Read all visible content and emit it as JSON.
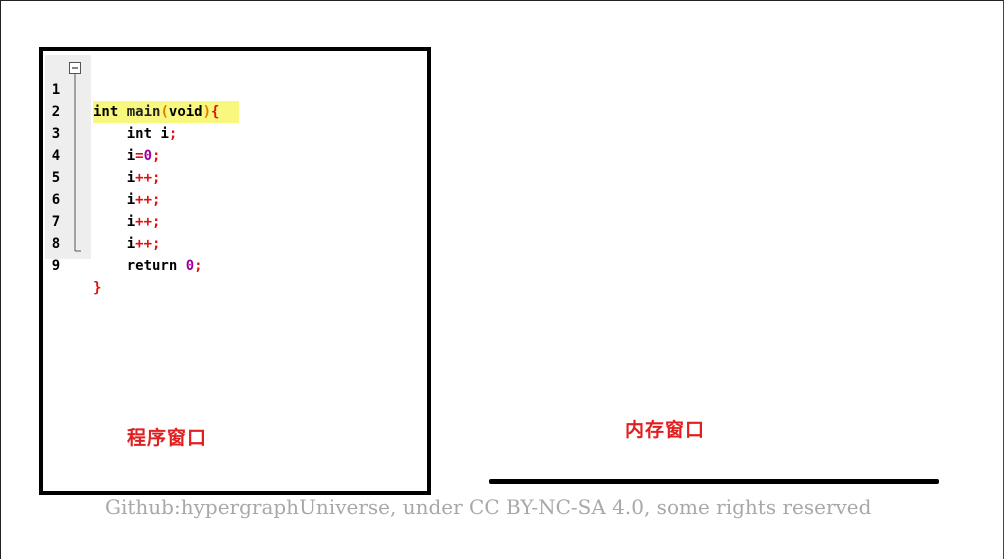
{
  "program_window": {
    "label": "程序窗口",
    "line_numbers": [
      "1",
      "2",
      "3",
      "4",
      "5",
      "6",
      "7",
      "8",
      "9"
    ],
    "code": {
      "line1": {
        "kw": "int",
        "fn": "main",
        "open": "(",
        "arg": "void",
        "close": ")",
        "brace": "{"
      },
      "line2": {
        "kw": "int",
        "ident": "i",
        "semi": ";"
      },
      "line3": {
        "ident": "i",
        "op": "=",
        "num": "0",
        "semi": ";"
      },
      "line4": {
        "ident": "i",
        "op": "++",
        "semi": ";"
      },
      "line5": {
        "ident": "i",
        "op": "++",
        "semi": ";"
      },
      "line6": {
        "ident": "i",
        "op": "++",
        "semi": ";"
      },
      "line7": {
        "ident": "i",
        "op": "++",
        "semi": ";"
      },
      "line8": {
        "kw": "return",
        "num": "0",
        "semi": ";"
      },
      "line9": {
        "brace": "}"
      }
    }
  },
  "memory_window": {
    "label": "内存窗口"
  },
  "footer": {
    "text": "Github:hypergraphUniverse, under CC BY-NC-SA 4.0, some rights reserved"
  },
  "colors": {
    "label_red": "#e02020",
    "highlight_yellow": "#f8f87e",
    "footer_gray": "#a8a8a8"
  }
}
